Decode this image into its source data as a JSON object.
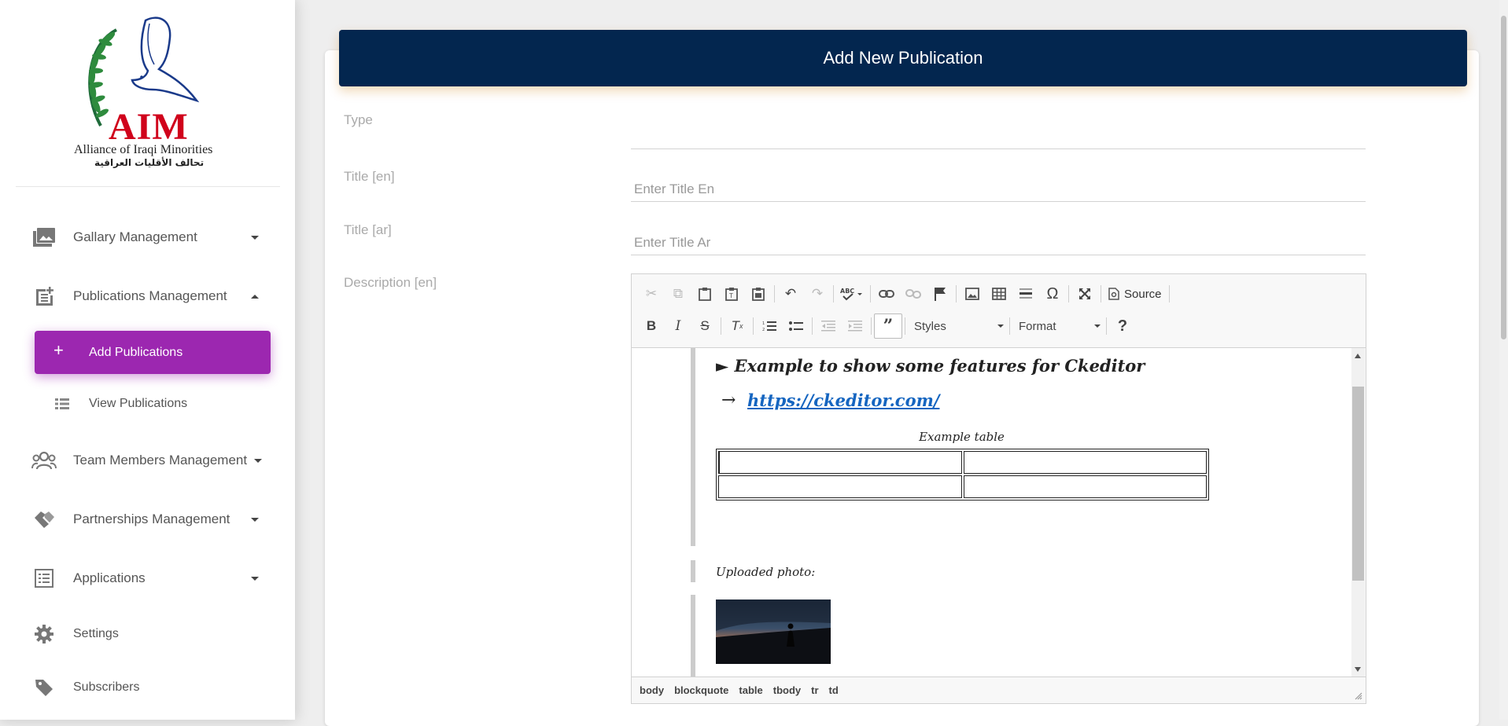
{
  "sidebar": {
    "logo": {
      "name": "AIM",
      "subtitle": "Alliance of Iraqi Minorities",
      "arabic": "تحالف الأقليات العراقية"
    },
    "items": [
      {
        "label": "Gallary Management",
        "icon": "photo-library-icon",
        "expanded": false
      },
      {
        "label": "Publications Management",
        "icon": "post-add-icon",
        "expanded": true,
        "children": [
          {
            "label": "Add Publications",
            "icon": "plus-icon",
            "active": true
          },
          {
            "label": "View Publications",
            "icon": "list-icon",
            "active": false
          }
        ]
      },
      {
        "label": "Team Members Management",
        "icon": "team-icon",
        "expanded": false
      },
      {
        "label": "Partnerships Management",
        "icon": "handshake-icon",
        "expanded": false
      },
      {
        "label": "Applications",
        "icon": "list-alt-icon",
        "expanded": false
      },
      {
        "label": "Settings",
        "icon": "gear-icon"
      },
      {
        "label": "Subscribers",
        "icon": "tag-icon"
      }
    ]
  },
  "main": {
    "header_title": "Add New Publication",
    "fields": {
      "type": {
        "label": "Type",
        "value": ""
      },
      "title_en": {
        "label": "Title [en]",
        "placeholder": "Enter Title En",
        "value": ""
      },
      "title_ar": {
        "label": "Title [ar]",
        "placeholder": "Enter Title Ar",
        "value": ""
      },
      "description_en": {
        "label": "Description [en]"
      }
    },
    "editor": {
      "toolbar": {
        "source_label": "Source",
        "styles_label": "Styles",
        "format_label": "Format",
        "help_label": "?"
      },
      "content": {
        "heading": "► Example to show some features for Ckeditor",
        "link_arrow": "→",
        "link": "https://ckeditor.com/",
        "table_caption": "Example table",
        "table_rows": 2,
        "table_cols": 2,
        "uploaded_label": "Uploaded photo:"
      },
      "path": [
        "body",
        "blockquote",
        "table",
        "tbody",
        "tr",
        "td"
      ]
    }
  },
  "colors": {
    "header_bg": "#03264f",
    "active_nav": "#9c27b0",
    "link": "#1565c0"
  }
}
